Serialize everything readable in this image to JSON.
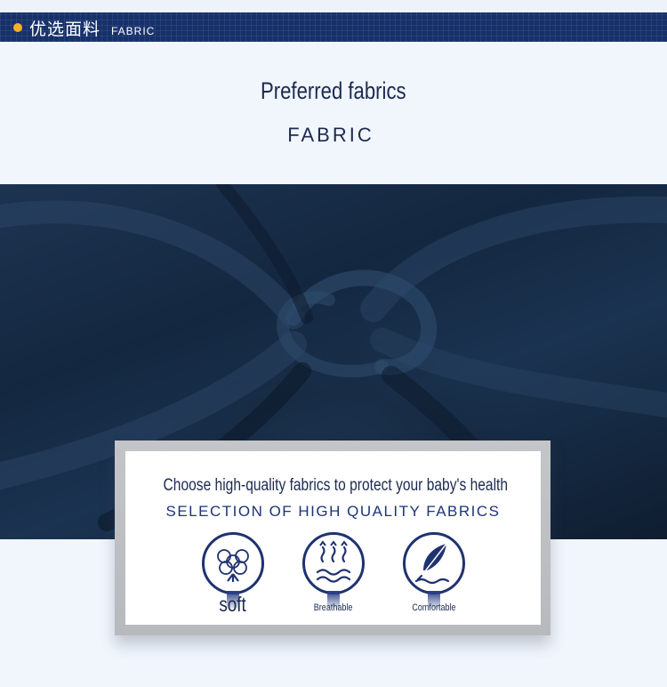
{
  "banner": {
    "title_cn": "优选面料",
    "title_en": "FABRIC"
  },
  "section": {
    "title": "Preferred fabrics",
    "subtitle": "FABRIC"
  },
  "card": {
    "headline": "Choose high-quality fabrics to protect your baby's health",
    "subheadline": "SELECTION OF HIGH QUALITY FABRICS",
    "features": [
      {
        "label": "soft",
        "icon": "cotton-icon"
      },
      {
        "label": "Breathable",
        "icon": "breathable-icon"
      },
      {
        "label": "Comfortable",
        "icon": "feather-icon"
      }
    ]
  },
  "colors": {
    "banner_bg": "#16306a",
    "accent_dot": "#f5b026",
    "text_dark_navy": "#1b2a4f",
    "card_sub_blue": "#1c3577",
    "icon_navy": "#1f3270",
    "page_bg": "#f1f6fd"
  }
}
